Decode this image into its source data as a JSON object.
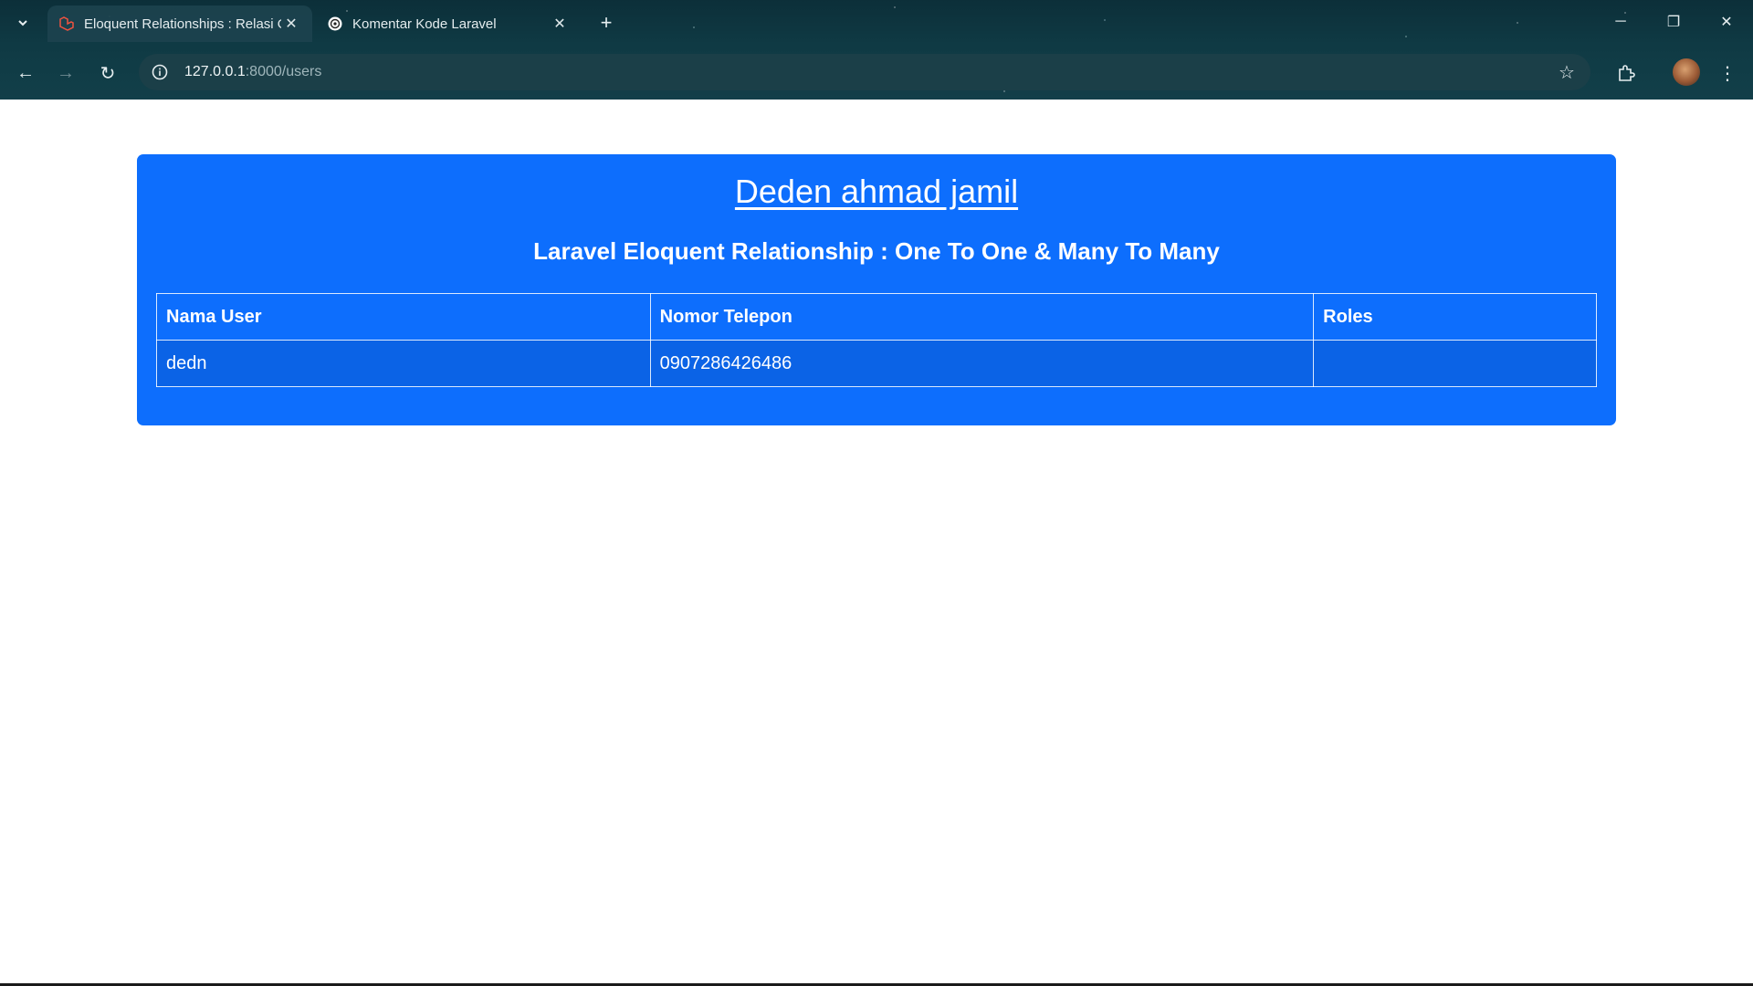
{
  "browser": {
    "tabs": [
      {
        "title": "Eloquent Relationships : Relasi O",
        "favicon": "laravel-icon",
        "active": true
      },
      {
        "title": "Komentar Kode Laravel",
        "favicon": "openai-icon",
        "active": false
      }
    ],
    "address_bar": {
      "host": "127.0.0.1",
      "rest": ":8000/users"
    }
  },
  "page": {
    "heading": "Deden ahmad jamil",
    "subheading": "Laravel Eloquent Relationship : One To One & Many To Many",
    "table": {
      "headers": [
        "Nama User",
        "Nomor Telepon",
        "Roles"
      ],
      "rows": [
        [
          "dedn",
          "0907286426486",
          ""
        ]
      ]
    },
    "colors": {
      "card_background": "#0d6efd",
      "text": "#ffffff"
    }
  }
}
